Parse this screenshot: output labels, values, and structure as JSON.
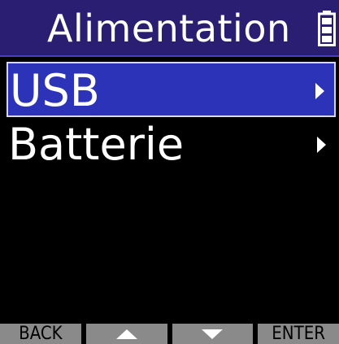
{
  "header": {
    "title": "Alimentation",
    "status_icon": "battery-icon"
  },
  "menu": {
    "items": [
      {
        "label": "USB",
        "selected": true,
        "icon": "chevron-right-icon"
      },
      {
        "label": "Batterie",
        "selected": false,
        "icon": "chevron-right-icon"
      }
    ]
  },
  "softkeys": {
    "back_label": "BACK",
    "up_icon": "up-arrow-icon",
    "down_icon": "down-arrow-icon",
    "enter_label": "ENTER"
  },
  "colors": {
    "title_bar": "#2a1e72",
    "selection": "#2c33b8",
    "softkey_bg": "#8a8a8a"
  }
}
